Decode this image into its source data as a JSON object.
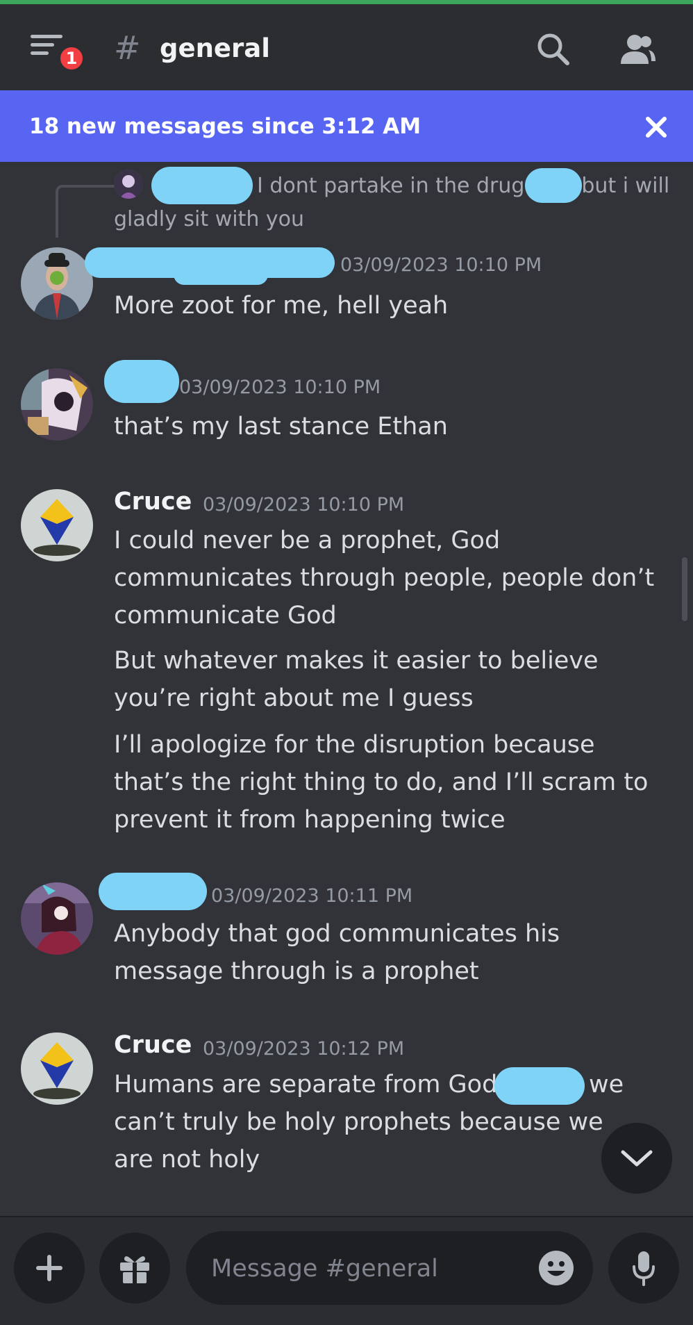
{
  "header": {
    "notification_count": "1",
    "channel_hash": "#",
    "channel_name": "general"
  },
  "banner": {
    "text": "18 new messages since 3:12 AM",
    "close_glyph": "✕"
  },
  "reply": {
    "text_a": "I dont partake in the drug",
    "text_b": "but i will",
    "text_c": "gladly sit with you"
  },
  "messages": [
    {
      "author": "",
      "timestamp": "03/09/2023 10:10 PM",
      "lines": [
        "More zoot for me, hell yeah"
      ]
    },
    {
      "author": "",
      "timestamp": "03/09/2023 10:10 PM",
      "lines": [
        "that’s my last stance Ethan"
      ]
    },
    {
      "author": "Cruce",
      "timestamp": "03/09/2023 10:10 PM",
      "lines": [
        "I could never be a prophet, God communicates through people, people don’t communicate God",
        "But whatever makes it easier to believe you’re right about me I guess",
        "I’ll apologize for the disruption because that’s the right thing to do, and I’ll scram to prevent it from happening twice"
      ]
    },
    {
      "author": "",
      "timestamp": "03/09/2023 10:11 PM",
      "lines": [
        "Anybody that god communicates his message through is a prophet"
      ]
    },
    {
      "author": "Cruce",
      "timestamp": "03/09/2023 10:12 PM",
      "lines": [
        "Humans are separate from God",
        "we",
        "can’t truly be holy prophets because we are not holy"
      ]
    }
  ],
  "composer": {
    "placeholder": "Message #general"
  },
  "icons": {
    "menu": "hamburger-menu-icon",
    "search": "search-icon",
    "members": "members-icon",
    "close": "close-icon",
    "jump": "chevron-down-icon",
    "add": "plus-icon",
    "gift": "gift-icon",
    "emoji": "emoji-icon",
    "mic": "microphone-icon"
  },
  "colors": {
    "background": "#313338",
    "header": "#2b2d31",
    "banner": "#5865f2",
    "badge": "#f23f43",
    "redaction": "#7fd3f7"
  }
}
